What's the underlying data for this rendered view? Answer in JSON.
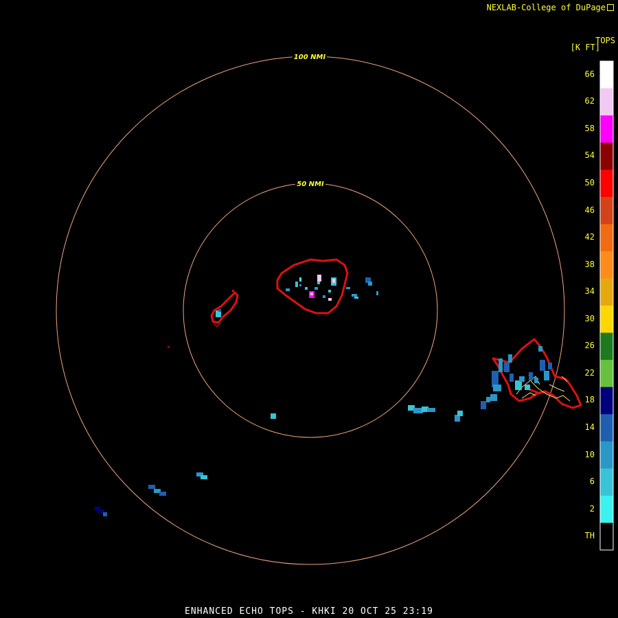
{
  "header": {
    "credit": "NEXLAB-College of DuPage",
    "credit_icon": "external-link-icon"
  },
  "range_rings": [
    {
      "label": "100 NMI"
    },
    {
      "label": "50 NMI"
    }
  ],
  "legend": {
    "title_line1": "TOPS",
    "title_line2": "[K FT]",
    "scale": [
      {
        "label": "66",
        "color": "#ffffff"
      },
      {
        "label": "62",
        "color": "#f2c9f2"
      },
      {
        "label": "58",
        "color": "#ff00ff"
      },
      {
        "label": "54",
        "color": "#8b0000"
      },
      {
        "label": "50",
        "color": "#ff0000"
      },
      {
        "label": "46",
        "color": "#d4421a"
      },
      {
        "label": "42",
        "color": "#f06b12"
      },
      {
        "label": "38",
        "color": "#ff8c1a"
      },
      {
        "label": "34",
        "color": "#e5a80e"
      },
      {
        "label": "30",
        "color": "#ffd700"
      },
      {
        "label": "26",
        "color": "#1e7a1e"
      },
      {
        "label": "22",
        "color": "#66c23c"
      },
      {
        "label": "18",
        "color": "#00007d"
      },
      {
        "label": "14",
        "color": "#1f5fb0"
      },
      {
        "label": "10",
        "color": "#2a97c9"
      },
      {
        "label": "6",
        "color": "#39c3d6"
      },
      {
        "label": "2",
        "color": "#3af3f0"
      },
      {
        "label": "TH",
        "color": "#000000"
      }
    ]
  },
  "footer": {
    "caption": "ENHANCED ECHO TOPS - KHKI 20 OCT 25 23:19"
  },
  "colors": {
    "background": "#000000",
    "ring": "#f0a880",
    "ring_label": "#ffff33",
    "outline": "#e01010",
    "county_lines": "#e8e070"
  }
}
